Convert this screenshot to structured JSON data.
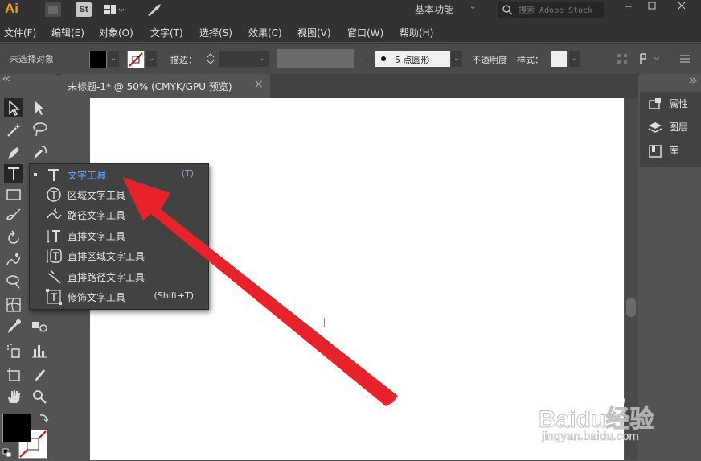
{
  "app": {
    "logo": "Ai",
    "bridge_label": "",
    "stock_label": "St"
  },
  "titlebar": {
    "workspace": "基本功能",
    "search_placeholder": "搜索 Adobe Stock"
  },
  "menu": [
    "文件(F)",
    "编辑(E)",
    "对象(O)",
    "文字(T)",
    "选择(S)",
    "效果(C)",
    "视图(V)",
    "窗口(W)",
    "帮助(H)"
  ],
  "control": {
    "selection_status": "未选择对象",
    "stroke_label": "描边：",
    "brush_value": "5 点圆形",
    "opacity_label": "不透明度",
    "style_label": "样式："
  },
  "document": {
    "tab_title": "未标题-1* @ 50% (CMYK/GPU 预览)",
    "tab_close": "×"
  },
  "right_panel": {
    "items": [
      "属性",
      "图层",
      "库"
    ]
  },
  "flyout": {
    "items": [
      {
        "label": "文字工具",
        "shortcut": "(T)",
        "selected": true
      },
      {
        "label": "区域文字工具",
        "shortcut": ""
      },
      {
        "label": "路径文字工具",
        "shortcut": ""
      },
      {
        "label": "直排文字工具",
        "shortcut": ""
      },
      {
        "label": "直排区域文字工具",
        "shortcut": ""
      },
      {
        "label": "直排路径文字工具",
        "shortcut": ""
      },
      {
        "label": "修饰文字工具",
        "shortcut": "(Shift+T)"
      }
    ]
  },
  "watermark": {
    "brand": "Baidu经验",
    "url": "jingyan.baidu.com"
  },
  "colors": {
    "accent_selected": "#6aa8ff",
    "annotation_arrow": "#e8222a",
    "logo_orange": "#ff9a00"
  },
  "icons": [
    "selection-icon",
    "direct-selection-icon",
    "magic-wand-icon",
    "lasso-icon",
    "pen-icon",
    "curvature-icon",
    "type-icon",
    "line-icon",
    "rectangle-icon",
    "paintbrush-icon",
    "rotate-icon",
    "scale-icon",
    "warp-icon",
    "free-transform-icon",
    "shape-builder-icon",
    "perspective-icon",
    "mesh-icon",
    "gradient-icon",
    "eyedropper-icon",
    "blend-icon",
    "symbol-sprayer-icon",
    "column-graph-icon",
    "artboard-icon",
    "slice-icon",
    "hand-icon",
    "zoom-icon"
  ]
}
